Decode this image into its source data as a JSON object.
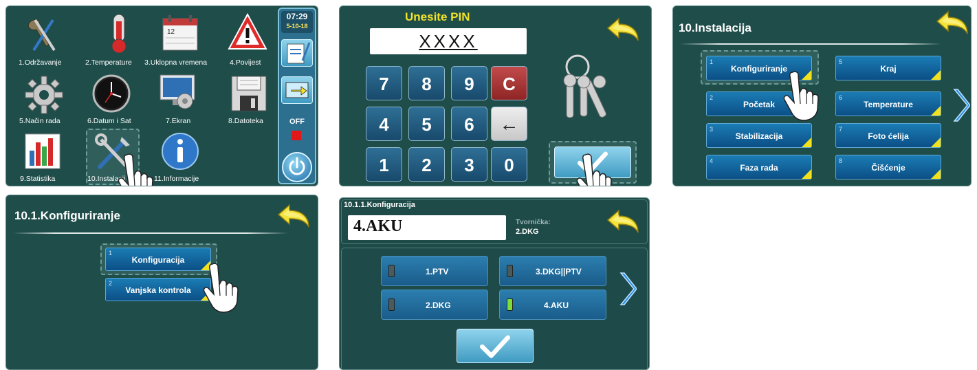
{
  "panel1": {
    "clock_time": "07:29",
    "clock_date": "5-10-18",
    "off_label": "OFF",
    "icons": [
      {
        "label": "1.Održavanje",
        "icon": "broom-pliers-icon"
      },
      {
        "label": "2.Temperature",
        "icon": "thermometer-icon"
      },
      {
        "label": "3.Uklopna vremena",
        "icon": "calendar-icon"
      },
      {
        "label": "4.Povijest",
        "icon": "warning-icon"
      },
      {
        "label": "5.Način rada",
        "icon": "gear-icon"
      },
      {
        "label": "6.Datum i Sat",
        "icon": "clock-icon"
      },
      {
        "label": "7.Ekran",
        "icon": "monitor-icon"
      },
      {
        "label": "8.Datoteka",
        "icon": "floppy-icon"
      },
      {
        "label": "9.Statistika",
        "icon": "bar-chart-icon"
      },
      {
        "label": "10.Instalacija",
        "icon": "tools-icon"
      },
      {
        "label": "11.Informacije",
        "icon": "info-icon"
      }
    ]
  },
  "panel2": {
    "title": "Unesite PIN",
    "pin_value": "XXXX",
    "keys": [
      "7",
      "8",
      "9",
      "C",
      "4",
      "5",
      "6",
      "←",
      "1",
      "2",
      "3",
      "0"
    ]
  },
  "panel3": {
    "title": "10.Instalacija",
    "buttons": [
      {
        "num": "1",
        "label": "Konfiguriranje"
      },
      {
        "num": "2",
        "label": "Početak"
      },
      {
        "num": "3",
        "label": "Stabilizacija"
      },
      {
        "num": "4",
        "label": "Faza rada"
      },
      {
        "num": "5",
        "label": "Kraj"
      },
      {
        "num": "6",
        "label": "Temperature"
      },
      {
        "num": "7",
        "label": "Foto ćelija"
      },
      {
        "num": "8",
        "label": "Čišćenje"
      }
    ]
  },
  "panel4": {
    "title": "10.1.Konfiguriranje",
    "buttons": [
      {
        "num": "1",
        "label": "Konfiguracija"
      },
      {
        "num": "2",
        "label": "Vanjska kontrola"
      }
    ]
  },
  "panel5": {
    "title": "10.1.1.Konfiguracija",
    "value": "4.AKU",
    "factory_label": "Tvornička:",
    "factory_value": "2.DKG",
    "options": [
      {
        "label": "1.PTV",
        "active": false
      },
      {
        "label": "3.DKG||PTV",
        "active": false
      },
      {
        "label": "2.DKG",
        "active": false
      },
      {
        "label": "4.AKU",
        "active": true
      }
    ]
  },
  "colors": {
    "panel_bg": "#1f4d4a",
    "button_blue": "#0b4f86",
    "accent_yellow": "#f3e21b",
    "title_yellow": "#f2e22a"
  }
}
